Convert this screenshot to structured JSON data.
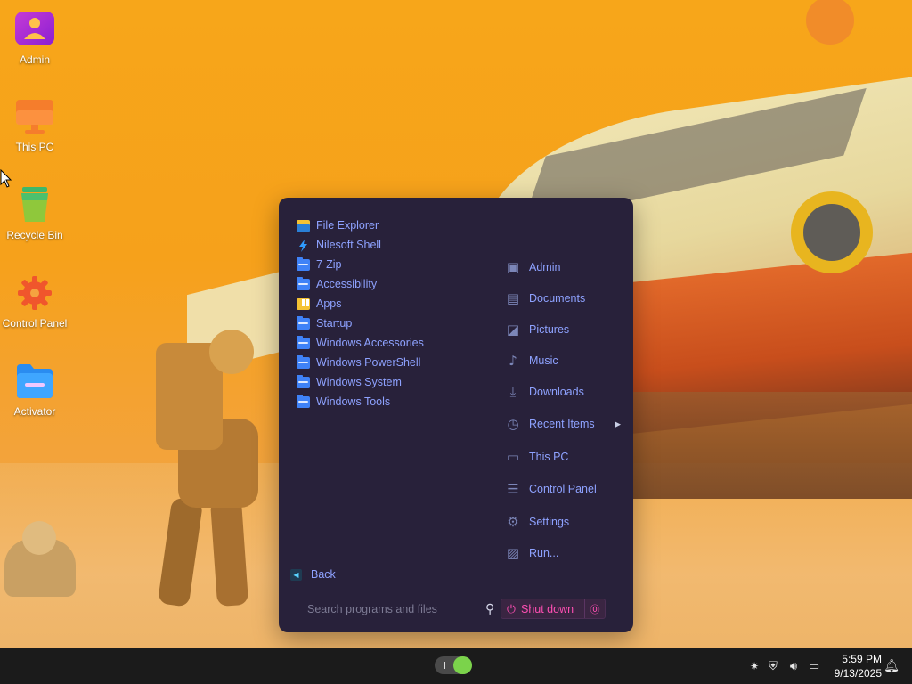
{
  "desktop": {
    "icons": [
      {
        "label": "Admin",
        "icon": "user-icon"
      },
      {
        "label": "This PC",
        "icon": "monitor-icon"
      },
      {
        "label": "Recycle Bin",
        "icon": "trash-icon"
      },
      {
        "label": "Control Panel",
        "icon": "gear-icon"
      },
      {
        "label": "Activator",
        "icon": "folder-icon"
      }
    ]
  },
  "start_menu": {
    "programs": [
      {
        "label": "File Explorer",
        "icon": "file-explorer-icon"
      },
      {
        "label": "Nilesoft Shell",
        "icon": "nilesoft-icon"
      },
      {
        "label": "7-Zip",
        "icon": "folder-icon"
      },
      {
        "label": "Accessibility",
        "icon": "folder-icon"
      },
      {
        "label": "Apps",
        "icon": "apps-icon"
      },
      {
        "label": "Startup",
        "icon": "folder-icon"
      },
      {
        "label": "Windows Accessories",
        "icon": "folder-icon"
      },
      {
        "label": "Windows PowerShell",
        "icon": "folder-icon"
      },
      {
        "label": "Windows System",
        "icon": "folder-icon"
      },
      {
        "label": "Windows Tools",
        "icon": "folder-icon"
      }
    ],
    "places": [
      {
        "label": "Admin",
        "icon": "user-icon"
      },
      {
        "label": "Documents",
        "icon": "document-icon"
      },
      {
        "label": "Pictures",
        "icon": "picture-icon"
      },
      {
        "label": "Music",
        "icon": "music-icon"
      },
      {
        "label": "Downloads",
        "icon": "download-icon"
      },
      {
        "label": "Recent Items",
        "icon": "clock-icon"
      },
      {
        "label": "This PC",
        "icon": "computer-icon"
      },
      {
        "label": "Control Panel",
        "icon": "control-panel-icon"
      },
      {
        "label": "Settings",
        "icon": "gear-icon"
      },
      {
        "label": "Run...",
        "icon": "run-icon"
      }
    ],
    "back_label": "Back",
    "search_placeholder": "Search programs and files",
    "shutdown_label": "Shut down"
  },
  "taskbar": {
    "time": "5:59 PM",
    "date": "9/13/2025"
  },
  "colors": {
    "menu_bg": "#28213a",
    "menu_text": "#8ea2ff",
    "accent_pink": "#ff4fb3",
    "taskbar_bg": "#1b1b1b"
  }
}
